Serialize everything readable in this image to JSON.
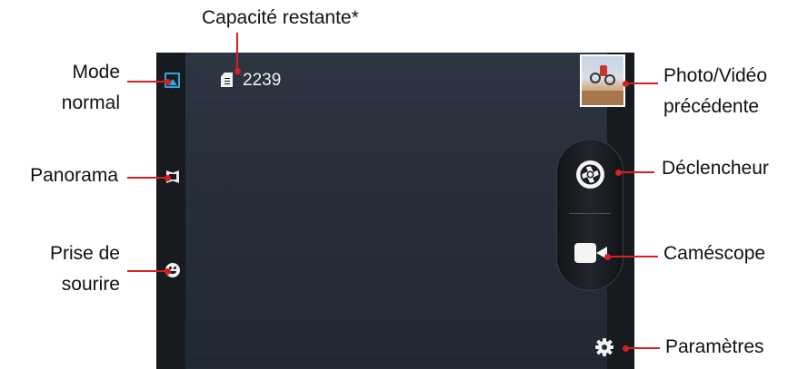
{
  "screen": {
    "capacity_value": "2239"
  },
  "callouts": {
    "capacity_label": "Capacité restante*",
    "mode_normal_line1": "Mode",
    "mode_normal_line2": "normal",
    "panorama": "Panorama",
    "smile_line1": "Prise de",
    "smile_line2": "sourire",
    "previous_line1": "Photo/Vidéo",
    "previous_line2": "précédente",
    "shutter": "Déclencheur",
    "camcorder": "Caméscope",
    "settings": "Paramètres"
  },
  "colors": {
    "leader": "#d42020",
    "mode_icon_accent": "#2aa7e6",
    "screen_background": "#252d39"
  },
  "icons": {
    "mode_normal": "picture-mode-icon",
    "panorama": "panorama-icon",
    "smile": "smile-icon",
    "storage": "sd-card-icon",
    "previous": "thumbnail-image",
    "shutter": "aperture-icon",
    "camcorder": "video-camera-icon",
    "settings": "gear-icon"
  }
}
